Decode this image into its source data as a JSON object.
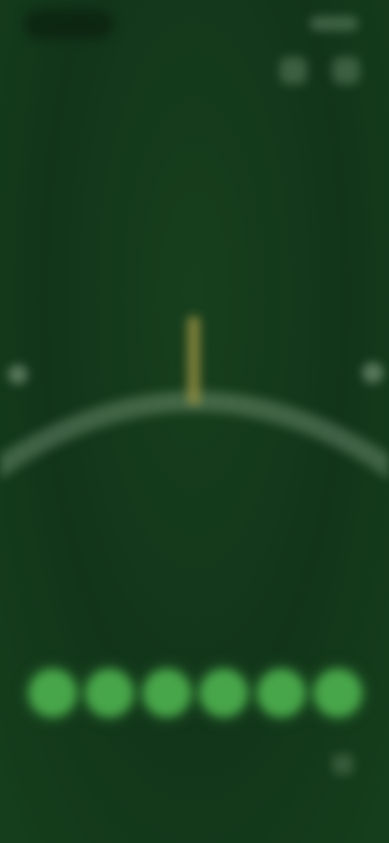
{
  "header": {
    "title": "",
    "icons": [
      "history-icon",
      "settings-icon"
    ]
  },
  "stats": {
    "left": {
      "value": "",
      "label": ""
    },
    "middle": {
      "value": ""
    },
    "right": {
      "value": "",
      "label": ""
    }
  },
  "prompt": {
    "title": "",
    "subtitle": ""
  },
  "pin_dots": 6,
  "bottom": {
    "label": ""
  },
  "colors": {
    "background": "#143a19",
    "accent": "#48a64a",
    "needle": "#8f8b3f"
  }
}
